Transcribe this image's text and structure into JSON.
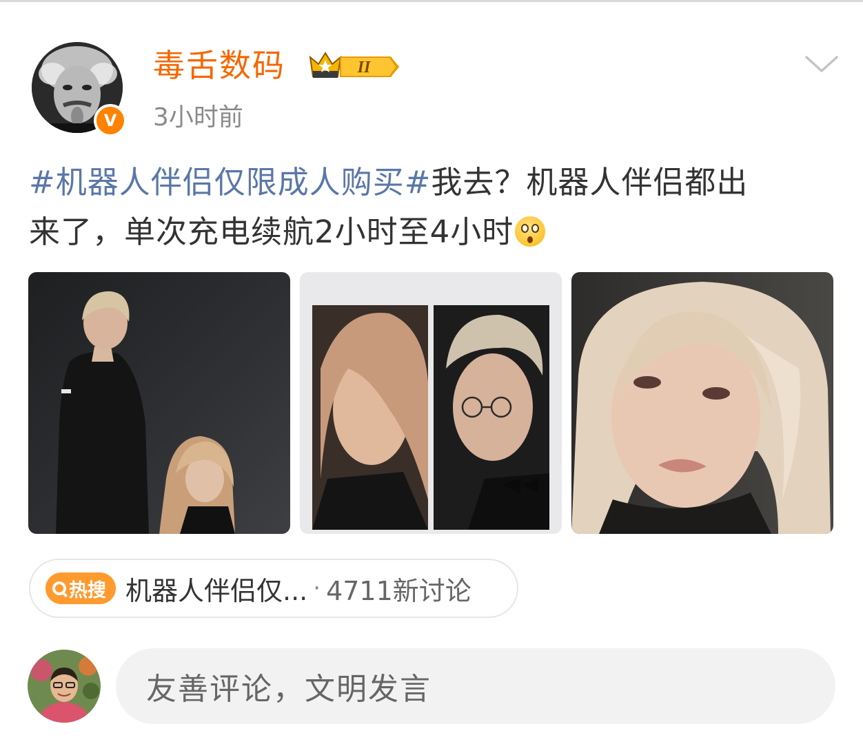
{
  "post": {
    "author": "毒舌数码",
    "member_level": "II",
    "time": "3小时前",
    "hashtag": "#机器人伴侣仅限成人购买#",
    "text_line1_rest": "我去？机器人伴侣都出",
    "text_line2": "来了，单次充电续航2小时至4小时",
    "emoji": "flushed-face-emoji"
  },
  "hot_search": {
    "badge": "热搜",
    "title": "机器人伴侣仅...",
    "separator": "·",
    "count": "4711新讨论"
  },
  "comment_bar": {
    "placeholder": "友善评论，文明发言"
  },
  "colors": {
    "author": "#f56700",
    "hashtag": "#5a77a8",
    "hot_badge": "#ff9a2e",
    "verified": "#ff8200"
  }
}
